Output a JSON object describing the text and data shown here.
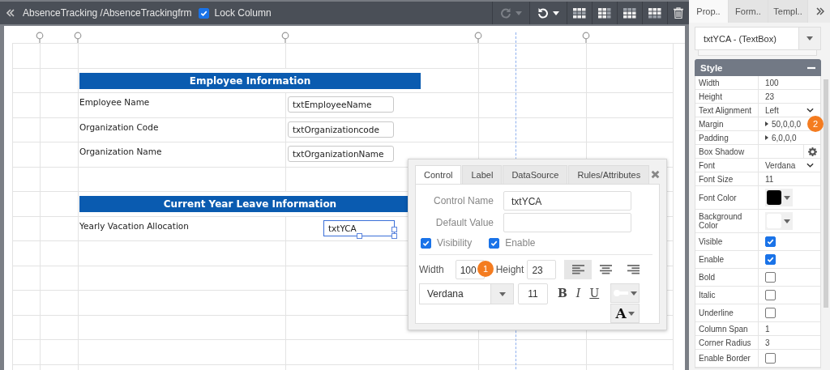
{
  "toolbar": {
    "breadcrumb": "AbsenceTracking /AbsenceTrackingfrm",
    "lock_column": {
      "label": "Lock Column",
      "checked": true
    },
    "history": [
      {
        "kind": "redo",
        "disabled": true
      },
      {
        "kind": "undo",
        "disabled": false
      }
    ]
  },
  "form": {
    "rows": [
      {
        "kind": "empty"
      },
      {
        "kind": "header",
        "text": "Employee Information"
      },
      {
        "kind": "field",
        "label": "Employee Name",
        "value": "txtEmployeeName",
        "selected": false
      },
      {
        "kind": "field",
        "label": "Organization Code",
        "value": "txtOrganizationcode",
        "selected": false
      },
      {
        "kind": "field",
        "label": "Organization Name",
        "value": "txtOrganizationName",
        "selected": false
      },
      {
        "kind": "empty"
      },
      {
        "kind": "header",
        "text": "Current Year Leave Information"
      },
      {
        "kind": "field",
        "label": "Yearly Vacation Allocation",
        "value": "txtYCA",
        "selected": true
      },
      {
        "kind": "empty"
      },
      {
        "kind": "empty"
      },
      {
        "kind": "empty"
      },
      {
        "kind": "empty"
      },
      {
        "kind": "empty"
      },
      {
        "kind": "empty"
      }
    ]
  },
  "dialog": {
    "tabs": [
      {
        "label": "Control",
        "selected": true
      },
      {
        "label": "Label",
        "selected": false
      },
      {
        "label": "DataSource",
        "selected": false
      },
      {
        "label": "Rules/Attributes",
        "selected": false
      }
    ],
    "fields": [
      {
        "label": "Control Name",
        "value": "txtYCA"
      },
      {
        "label": "Default Value"
      }
    ],
    "options": [
      {
        "label": "Visibility",
        "checked": true
      },
      {
        "label": "Enable",
        "checked": true
      }
    ],
    "width": {
      "label": "Width",
      "value": "100",
      "callout": "1"
    },
    "height": {
      "label": "Height",
      "value": "23"
    },
    "alignments": [
      {
        "kind": "left",
        "selected": true
      },
      {
        "kind": "center",
        "selected": false
      },
      {
        "kind": "right",
        "selected": false
      }
    ],
    "font": "Verdana",
    "font_size": "11",
    "styles": [
      "B",
      "I",
      "U"
    ],
    "text_color": "A"
  },
  "properties": {
    "tabs": [
      {
        "label": "Prop..",
        "selected": true
      },
      {
        "label": "Form..",
        "selected": false
      },
      {
        "label": "Templ..",
        "selected": false
      }
    ],
    "selector": "txtYCA - (TextBox)",
    "section": {
      "title": "Style",
      "expanded": true
    },
    "items": [
      {
        "kind": "text",
        "label": "Width",
        "value": "100"
      },
      {
        "kind": "text",
        "label": "Height",
        "value": "23"
      },
      {
        "kind": "select",
        "label": "Text Alignment",
        "value": "Left"
      },
      {
        "kind": "expandable",
        "label": "Margin",
        "value": "50,0,0,0",
        "callout": "2"
      },
      {
        "kind": "expandable",
        "label": "Padding",
        "value": "6,0,0,0"
      },
      {
        "kind": "button",
        "label": "Box Shadow"
      },
      {
        "kind": "select",
        "label": "Font",
        "value": "Verdana"
      },
      {
        "kind": "text",
        "label": "Font Size",
        "value": "11"
      },
      {
        "kind": "color",
        "label": "Font Color",
        "color": "#000000"
      },
      {
        "kind": "color",
        "label": "Background Color",
        "color": "#ffffff"
      },
      {
        "kind": "checkbox",
        "label": "Visible",
        "checked": true
      },
      {
        "kind": "checkbox",
        "label": "Enable",
        "checked": true
      },
      {
        "kind": "checkbox",
        "label": "Bold",
        "checked": false
      },
      {
        "kind": "checkbox",
        "label": "Italic",
        "checked": false
      },
      {
        "kind": "checkbox",
        "label": "Underline",
        "checked": false
      },
      {
        "kind": "text",
        "label": "Column Span",
        "value": "1"
      },
      {
        "kind": "text",
        "label": "Corner Radius",
        "value": "3"
      },
      {
        "kind": "checkbox",
        "label": "Enable Border",
        "checked": false
      }
    ]
  }
}
